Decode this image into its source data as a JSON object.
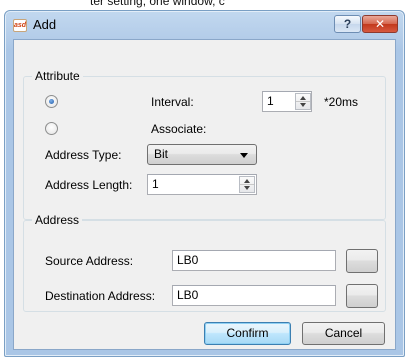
{
  "background": {
    "cut_text": "ter setting, one window, c"
  },
  "window": {
    "app_icon_text": "asd",
    "title": "Add",
    "help_label": "?",
    "close_label": "✕"
  },
  "attribute": {
    "group_title": "Attribute",
    "interval_label": "Interval:",
    "interval_value": "1",
    "interval_unit": "*20ms",
    "associate_label": "Associate:",
    "address_type_label": "Address Type:",
    "address_type_value": "Bit",
    "address_length_label": "Address Length:",
    "address_length_value": "1",
    "selected_mode": "interval"
  },
  "address": {
    "group_title": "Address",
    "source_label": "Source Address:",
    "source_value": "LB0",
    "destination_label": "Destination Address:",
    "destination_value": "LB0"
  },
  "buttons": {
    "confirm": "Confirm",
    "cancel": "Cancel"
  },
  "colors": {
    "frame": "#b4cde9",
    "panel": "#f0f0f0",
    "close_button": "#c2381c",
    "default_button_border": "#3c7fb1"
  }
}
